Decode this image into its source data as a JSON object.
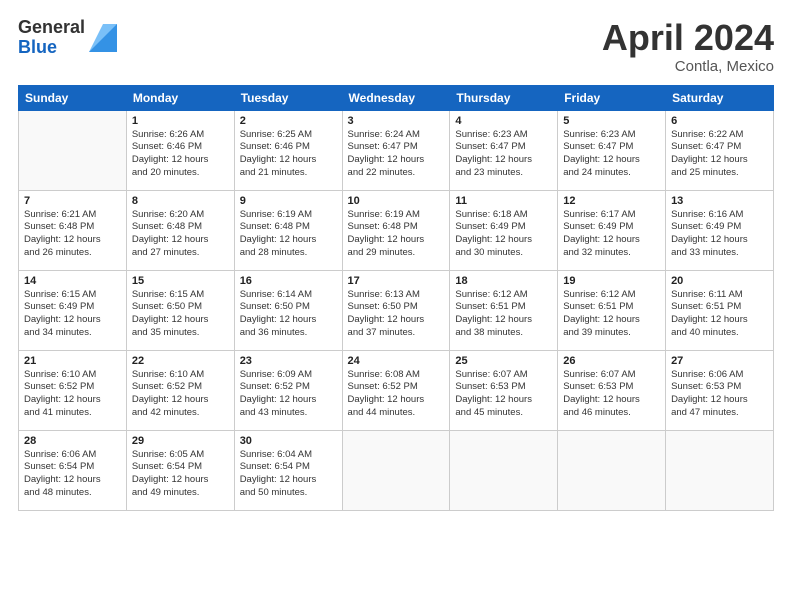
{
  "header": {
    "logo_general": "General",
    "logo_blue": "Blue",
    "title": "April 2024",
    "location": "Contla, Mexico"
  },
  "days_of_week": [
    "Sunday",
    "Monday",
    "Tuesday",
    "Wednesday",
    "Thursday",
    "Friday",
    "Saturday"
  ],
  "weeks": [
    [
      {
        "day": "",
        "info": ""
      },
      {
        "day": "1",
        "info": "Sunrise: 6:26 AM\nSunset: 6:46 PM\nDaylight: 12 hours\nand 20 minutes."
      },
      {
        "day": "2",
        "info": "Sunrise: 6:25 AM\nSunset: 6:46 PM\nDaylight: 12 hours\nand 21 minutes."
      },
      {
        "day": "3",
        "info": "Sunrise: 6:24 AM\nSunset: 6:47 PM\nDaylight: 12 hours\nand 22 minutes."
      },
      {
        "day": "4",
        "info": "Sunrise: 6:23 AM\nSunset: 6:47 PM\nDaylight: 12 hours\nand 23 minutes."
      },
      {
        "day": "5",
        "info": "Sunrise: 6:23 AM\nSunset: 6:47 PM\nDaylight: 12 hours\nand 24 minutes."
      },
      {
        "day": "6",
        "info": "Sunrise: 6:22 AM\nSunset: 6:47 PM\nDaylight: 12 hours\nand 25 minutes."
      }
    ],
    [
      {
        "day": "7",
        "info": "Sunrise: 6:21 AM\nSunset: 6:48 PM\nDaylight: 12 hours\nand 26 minutes."
      },
      {
        "day": "8",
        "info": "Sunrise: 6:20 AM\nSunset: 6:48 PM\nDaylight: 12 hours\nand 27 minutes."
      },
      {
        "day": "9",
        "info": "Sunrise: 6:19 AM\nSunset: 6:48 PM\nDaylight: 12 hours\nand 28 minutes."
      },
      {
        "day": "10",
        "info": "Sunrise: 6:19 AM\nSunset: 6:48 PM\nDaylight: 12 hours\nand 29 minutes."
      },
      {
        "day": "11",
        "info": "Sunrise: 6:18 AM\nSunset: 6:49 PM\nDaylight: 12 hours\nand 30 minutes."
      },
      {
        "day": "12",
        "info": "Sunrise: 6:17 AM\nSunset: 6:49 PM\nDaylight: 12 hours\nand 32 minutes."
      },
      {
        "day": "13",
        "info": "Sunrise: 6:16 AM\nSunset: 6:49 PM\nDaylight: 12 hours\nand 33 minutes."
      }
    ],
    [
      {
        "day": "14",
        "info": "Sunrise: 6:15 AM\nSunset: 6:49 PM\nDaylight: 12 hours\nand 34 minutes."
      },
      {
        "day": "15",
        "info": "Sunrise: 6:15 AM\nSunset: 6:50 PM\nDaylight: 12 hours\nand 35 minutes."
      },
      {
        "day": "16",
        "info": "Sunrise: 6:14 AM\nSunset: 6:50 PM\nDaylight: 12 hours\nand 36 minutes."
      },
      {
        "day": "17",
        "info": "Sunrise: 6:13 AM\nSunset: 6:50 PM\nDaylight: 12 hours\nand 37 minutes."
      },
      {
        "day": "18",
        "info": "Sunrise: 6:12 AM\nSunset: 6:51 PM\nDaylight: 12 hours\nand 38 minutes."
      },
      {
        "day": "19",
        "info": "Sunrise: 6:12 AM\nSunset: 6:51 PM\nDaylight: 12 hours\nand 39 minutes."
      },
      {
        "day": "20",
        "info": "Sunrise: 6:11 AM\nSunset: 6:51 PM\nDaylight: 12 hours\nand 40 minutes."
      }
    ],
    [
      {
        "day": "21",
        "info": "Sunrise: 6:10 AM\nSunset: 6:52 PM\nDaylight: 12 hours\nand 41 minutes."
      },
      {
        "day": "22",
        "info": "Sunrise: 6:10 AM\nSunset: 6:52 PM\nDaylight: 12 hours\nand 42 minutes."
      },
      {
        "day": "23",
        "info": "Sunrise: 6:09 AM\nSunset: 6:52 PM\nDaylight: 12 hours\nand 43 minutes."
      },
      {
        "day": "24",
        "info": "Sunrise: 6:08 AM\nSunset: 6:52 PM\nDaylight: 12 hours\nand 44 minutes."
      },
      {
        "day": "25",
        "info": "Sunrise: 6:07 AM\nSunset: 6:53 PM\nDaylight: 12 hours\nand 45 minutes."
      },
      {
        "day": "26",
        "info": "Sunrise: 6:07 AM\nSunset: 6:53 PM\nDaylight: 12 hours\nand 46 minutes."
      },
      {
        "day": "27",
        "info": "Sunrise: 6:06 AM\nSunset: 6:53 PM\nDaylight: 12 hours\nand 47 minutes."
      }
    ],
    [
      {
        "day": "28",
        "info": "Sunrise: 6:06 AM\nSunset: 6:54 PM\nDaylight: 12 hours\nand 48 minutes."
      },
      {
        "day": "29",
        "info": "Sunrise: 6:05 AM\nSunset: 6:54 PM\nDaylight: 12 hours\nand 49 minutes."
      },
      {
        "day": "30",
        "info": "Sunrise: 6:04 AM\nSunset: 6:54 PM\nDaylight: 12 hours\nand 50 minutes."
      },
      {
        "day": "",
        "info": ""
      },
      {
        "day": "",
        "info": ""
      },
      {
        "day": "",
        "info": ""
      },
      {
        "day": "",
        "info": ""
      }
    ]
  ]
}
